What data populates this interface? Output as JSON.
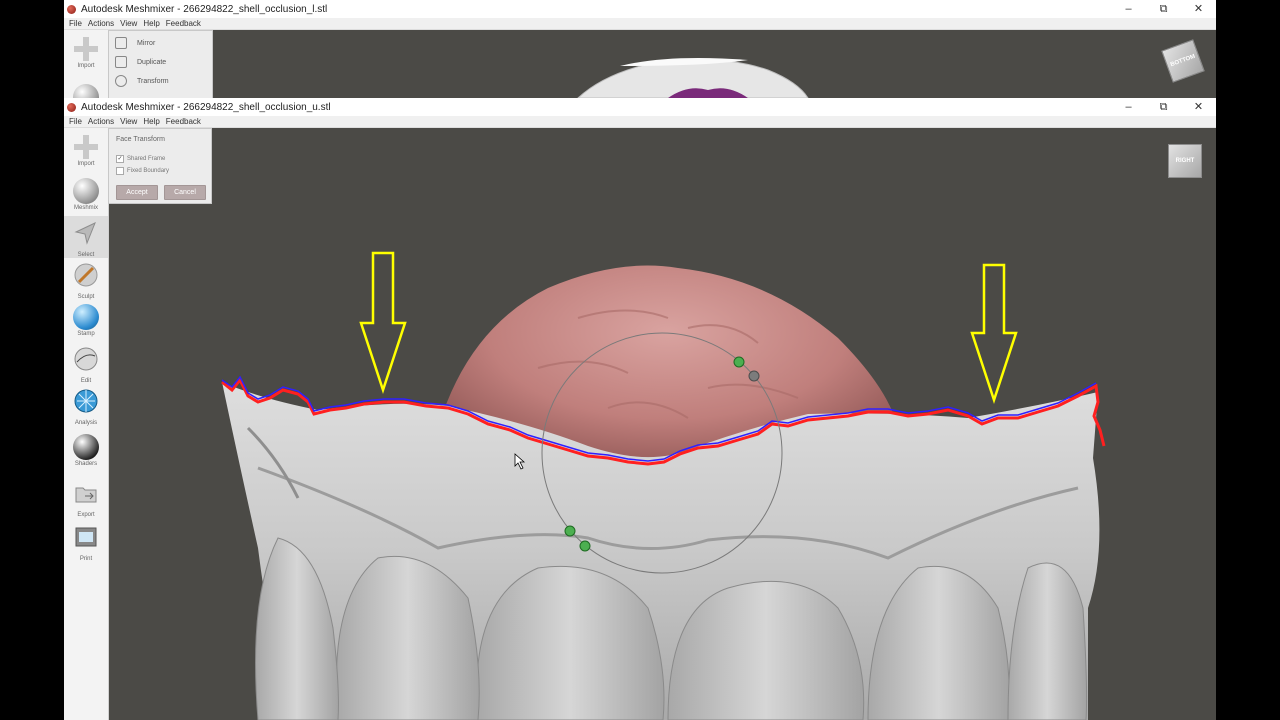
{
  "back_window": {
    "title": "Autodesk Meshmixer - 266294822_shell_occlusion_l.stl",
    "menu": [
      "File",
      "Actions",
      "View",
      "Help",
      "Feedback"
    ],
    "controls": [
      "–",
      "⧉",
      "✕"
    ],
    "tool_import_label": "Import",
    "actions": [
      "Mirror",
      "Duplicate",
      "Transform"
    ],
    "view_cube_label": "BOTTOM"
  },
  "front_window": {
    "title": "Autodesk Meshmixer - 266294822_shell_occlusion_u.stl",
    "menu": [
      "File",
      "Actions",
      "View",
      "Help",
      "Feedback"
    ],
    "controls": [
      "–",
      "⧉",
      "✕"
    ],
    "tools": [
      "Import",
      "Meshmix",
      "Select",
      "Sculpt",
      "Stamp",
      "Edit",
      "Analysis",
      "Shaders",
      "Export",
      "Print"
    ],
    "active_tool": "Select",
    "face_transform": {
      "title": "Face Transform",
      "shared_frame_label": "Shared Frame",
      "shared_frame_checked": true,
      "fixed_boundary_label": "Fixed Boundary",
      "fixed_boundary_checked": false,
      "accept_label": "Accept",
      "cancel_label": "Cancel"
    },
    "view_cube_label": "RIGHT"
  },
  "annotations": {
    "arrow_color": "#ffff00"
  },
  "colors": {
    "viewport": "#4b4a46",
    "gum": "#c98785",
    "boundary_red": "#ff2020",
    "boundary_blue": "#3020ff"
  }
}
